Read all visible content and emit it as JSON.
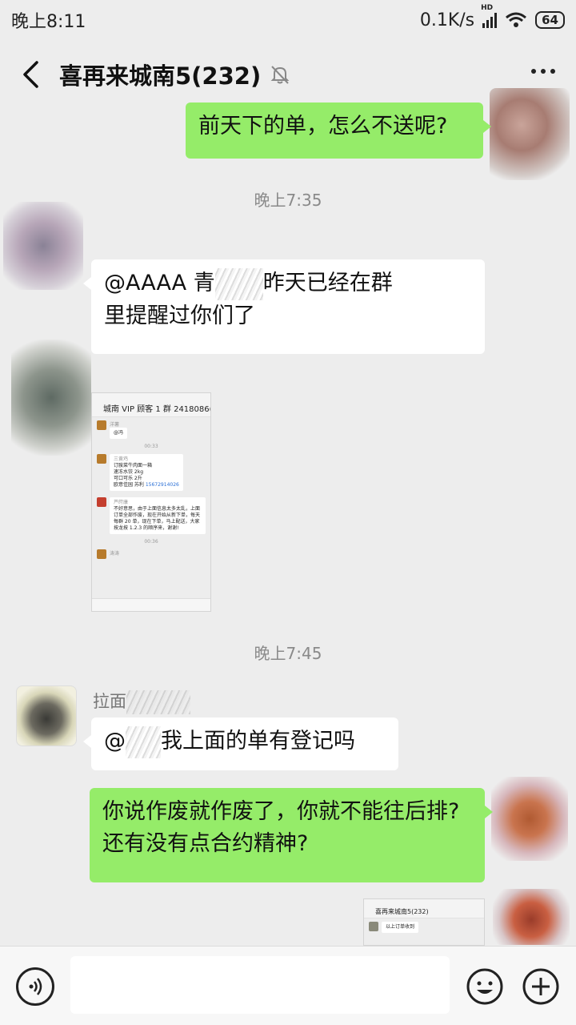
{
  "status_bar": {
    "time": "晚上8:11",
    "network_speed": "0.1K/s",
    "signal_badge": "HD",
    "battery": "64"
  },
  "header": {
    "title": "喜再来城南5(232)",
    "icons": [
      "back-arrow-icon",
      "mute-bell-icon",
      "more-icon"
    ]
  },
  "messages": {
    "m1_text": "前天下的单，怎么不送呢?",
    "time1": "晚上7:35",
    "m2_prefix": "@AAAA 青",
    "m2_line1_suffix": "昨天已经在群",
    "m2_line2": "里提醒过你们了",
    "time2": "晚上7:45",
    "m4_sender": "拉面",
    "m4_prefix": "@",
    "m4_suffix": "我上面的单有登记吗",
    "m5_text": "你说作废就作废了，你就不能往后排? 还有没有点合约精神?"
  },
  "screenshot1": {
    "title": "城南 VIP 顾客 1 群 2418086(401)",
    "name_a": "洋薯",
    "msg_a": "@冯",
    "time_a": "00:33",
    "name_b": "三黄鸡",
    "order1": [
      "订胺菜牛肉面一箱",
      "速冻水饺 2kg",
      "可口可乐 2升",
      "欧意佳园  苏利"
    ],
    "phone": "15672914026",
    "name_c": "芦莳康",
    "notice": "不好意思，由于上面信息太多太乱，上面订单全部作废，现在开始从新下单，每天每群 20 单，现在下单，马上配送，大家按龙按 1.2.3 的顺序来，谢谢!",
    "name_d": "三黄鸡",
    "time_b": "00:36",
    "name_e": "涛涛"
  },
  "screenshot2": {
    "title": "喜再来城南5(232)",
    "msg": "以上订单收到"
  },
  "bottom_bar": {
    "icons": [
      "voice-icon",
      "emoji-icon",
      "plus-icon"
    ]
  }
}
